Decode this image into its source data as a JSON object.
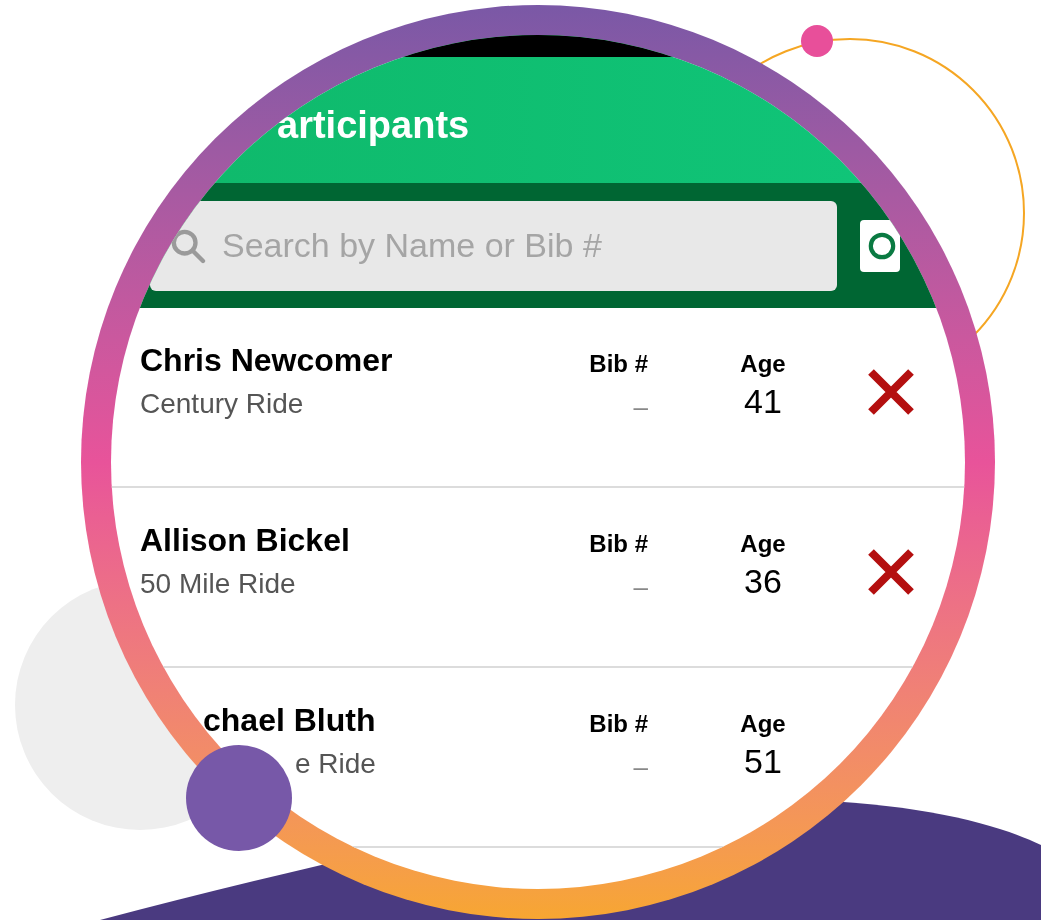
{
  "header": {
    "title": "articipants"
  },
  "search": {
    "placeholder": "Search by Name or Bib #"
  },
  "participants": [
    {
      "name": "Chris Newcomer",
      "event": "Century Ride",
      "bib_label": "Bib #",
      "bib": "–",
      "age_label": "Age",
      "age": "41"
    },
    {
      "name": "Allison Bickel",
      "event": "50 Mile Ride",
      "bib_label": "Bib #",
      "bib": "–",
      "age_label": "Age",
      "age": "36"
    },
    {
      "name": "chael Bluth",
      "event": "e Ride",
      "bib_label": "Bib #",
      "bib": "–",
      "age_label": "Age",
      "age": "51"
    }
  ]
}
